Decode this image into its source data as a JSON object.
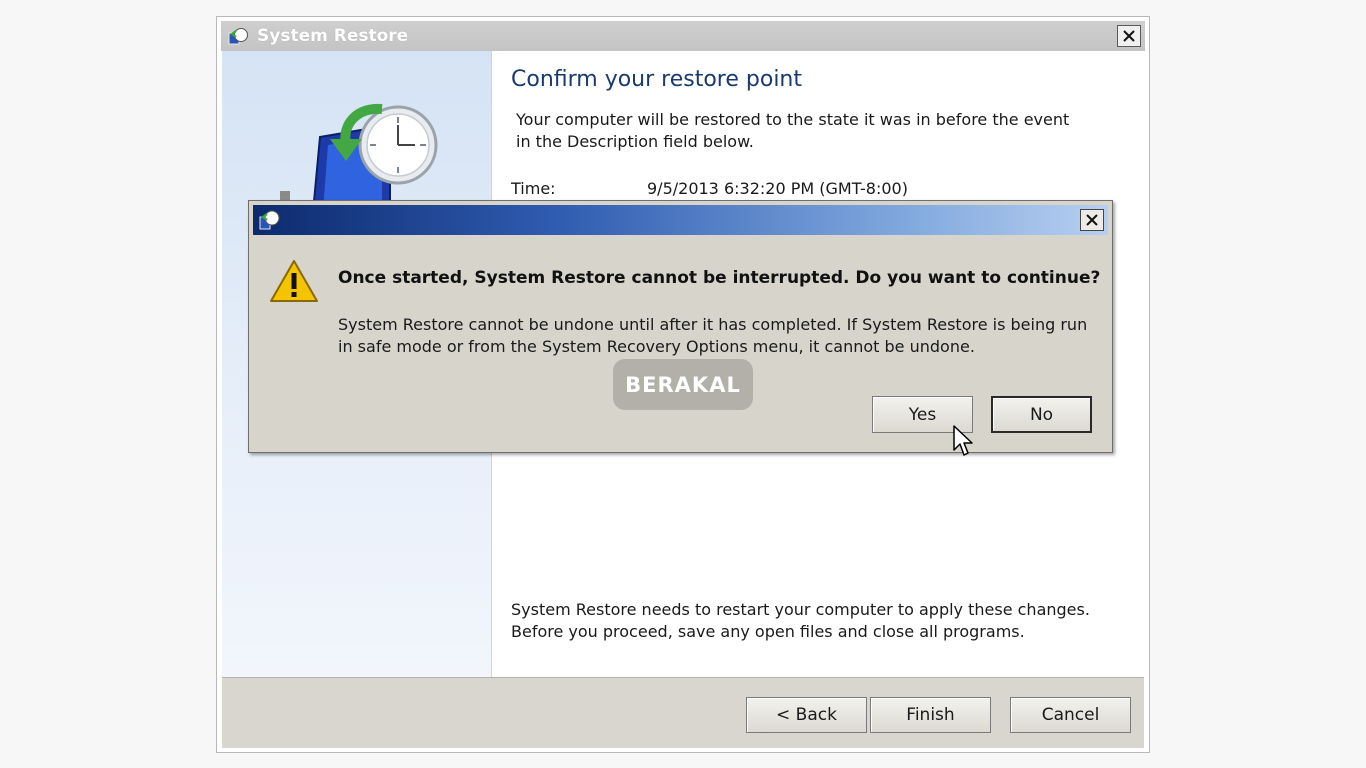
{
  "window": {
    "title": "System Restore",
    "heading": "Confirm your restore point",
    "description": "Your computer will be restored to the state it was in before the event in the Description field below.",
    "time_label": "Time:",
    "time_value": "9/5/2013 6:32:20 PM (GMT-8:00)",
    "restart_note": "System Restore needs to restart your computer to apply these changes. Before you proceed, save any open files and close all programs.",
    "buttons": {
      "back": "< Back",
      "finish": "Finish",
      "cancel": "Cancel"
    }
  },
  "dialog": {
    "question": "Once started, System Restore cannot be interrupted. Do you want to continue?",
    "detail": "System Restore cannot be undone until after it has completed. If System Restore is being run in safe mode or from the System Recovery Options menu, it cannot be undone.",
    "buttons": {
      "yes": "Yes",
      "no": "No"
    }
  },
  "watermark": "BERAKAL",
  "icons": [
    "system-restore-icon",
    "close-icon",
    "warning-icon",
    "restore-clock-icon",
    "mouse-cursor-icon"
  ],
  "colors": {
    "heading": "#1a3a6e",
    "dialog_title_gradient_start": "#0d2a6e",
    "dialog_title_gradient_end": "#b7cff0",
    "dialog_background": "#d7d4cc",
    "warning_yellow": "#f5c400"
  }
}
